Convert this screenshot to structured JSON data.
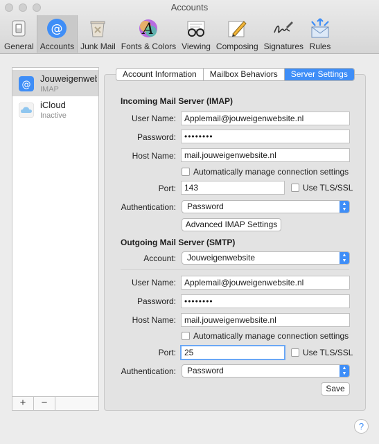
{
  "window": {
    "title": "Accounts"
  },
  "toolbar": {
    "items": [
      {
        "label": "General",
        "icon": "general-switch-icon"
      },
      {
        "label": "Accounts",
        "icon": "at-sign-icon"
      },
      {
        "label": "Junk Mail",
        "icon": "trash-bin-icon"
      },
      {
        "label": "Fonts & Colors",
        "icon": "fonts-icon"
      },
      {
        "label": "Viewing",
        "icon": "glasses-icon"
      },
      {
        "label": "Composing",
        "icon": "pencil-icon"
      },
      {
        "label": "Signatures",
        "icon": "signature-icon"
      },
      {
        "label": "Rules",
        "icon": "rules-envelope-icon"
      }
    ],
    "active_index": 1
  },
  "accounts": [
    {
      "name": "Jouweigenwebsite",
      "sub": "IMAP"
    },
    {
      "name": "iCloud",
      "sub": "Inactive"
    }
  ],
  "sidebar_footer": {
    "add": "+",
    "remove": "−"
  },
  "tabs": [
    {
      "label": "Account Information"
    },
    {
      "label": "Mailbox Behaviors"
    },
    {
      "label": "Server Settings"
    }
  ],
  "incoming": {
    "title": "Incoming Mail Server (IMAP)",
    "user_label": "User Name:",
    "user_value": "Applemail@jouweigenwebsite.nl",
    "password_label": "Password:",
    "password_value": "••••••••",
    "host_label": "Host Name:",
    "host_value": "mail.jouweigenwebsite.nl",
    "auto_manage_label": "Automatically manage connection settings",
    "port_label": "Port:",
    "port_value": "143",
    "tls_label": "Use TLS/SSL",
    "auth_label": "Authentication:",
    "auth_value": "Password",
    "advanced_button": "Advanced IMAP Settings"
  },
  "outgoing": {
    "title": "Outgoing Mail Server (SMTP)",
    "account_label": "Account:",
    "account_value": "Jouweigenwebsite",
    "user_label": "User Name:",
    "user_value": "Applemail@jouweigenwebsite.nl",
    "password_label": "Password:",
    "password_value": "••••••••",
    "host_label": "Host Name:",
    "host_value": "mail.jouweigenwebsite.nl",
    "auto_manage_label": "Automatically manage connection settings",
    "port_label": "Port:",
    "port_value": "25",
    "tls_label": "Use TLS/SSL",
    "auth_label": "Authentication:",
    "auth_value": "Password"
  },
  "save_button": "Save",
  "help_button": "?",
  "colors": {
    "accent": "#3f8ef7",
    "window_bg": "#ececec",
    "panel_bg": "#e3e3e3"
  }
}
